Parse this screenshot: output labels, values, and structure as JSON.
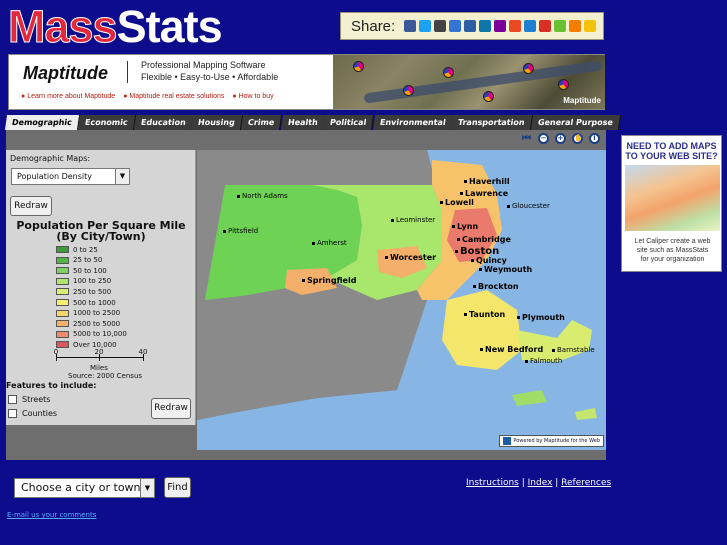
{
  "site": {
    "logo_mass": "Mass",
    "logo_stats": "Stats"
  },
  "share": {
    "label": "Share:",
    "icons": [
      "facebook-icon",
      "twitter-icon",
      "myspace-icon",
      "delicious-icon",
      "digg-icon",
      "linkedin-icon",
      "yahoo-icon",
      "stumbleupon-icon",
      "friendfeed-icon",
      "gmail-icon",
      "technorati-icon",
      "blogger-icon",
      "favorites-icon"
    ],
    "icon_colors": [
      "#3b5998",
      "#1da1f2",
      "#444444",
      "#3274d2",
      "#2d5ea3",
      "#0e76a8",
      "#7b0099",
      "#eb4924",
      "#1f7fd1",
      "#d93025",
      "#69c030",
      "#f57d00",
      "#f4c20d"
    ]
  },
  "banner": {
    "logo": "Maptitude",
    "tagline1": "Professional Mapping Software",
    "tagline2": "Flexible • Easy-to-Use • Affordable",
    "links": [
      "Learn more about Maptitude",
      "Maptitude real estate solutions",
      "How to buy"
    ],
    "map_badge": "Maptitude"
  },
  "tabs": [
    "Demographic",
    "Economic",
    "Education",
    "Housing",
    "Crime",
    "Health",
    "Political",
    "Environmental",
    "Transportation",
    "General Purpose"
  ],
  "active_tab": "Demographic",
  "toolbar": {
    "icons": [
      "first-page-icon",
      "zoom-out-icon",
      "zoom-in-icon",
      "pan-hand-icon",
      "info-icon"
    ],
    "glyphs": [
      "⏮",
      "−",
      "+",
      "✋",
      "i"
    ]
  },
  "sidebar": {
    "map_label": "Demographic Maps:",
    "map_select": "Population Density",
    "redraw_label": "Redraw",
    "legend_title": "Population Per Square Mile",
    "legend_subtitle": "(By City/Town)",
    "legend": [
      {
        "label": "0 to 25",
        "color": "#3f9b3a"
      },
      {
        "label": "25 to 50",
        "color": "#54b446"
      },
      {
        "label": "50 to 100",
        "color": "#7fd060"
      },
      {
        "label": "100 to 250",
        "color": "#aee66f"
      },
      {
        "label": "250 to 500",
        "color": "#d6ee72"
      },
      {
        "label": "500 to 1000",
        "color": "#f7ef6b"
      },
      {
        "label": "1000 to 2500",
        "color": "#f8d36a"
      },
      {
        "label": "2500 to 5000",
        "color": "#f5b06a"
      },
      {
        "label": "5000 to 10,000",
        "color": "#ee8a6f"
      },
      {
        "label": "Over 10,000",
        "color": "#d85a60"
      }
    ],
    "scale_ticks": [
      "0",
      "20",
      "40"
    ],
    "scale_unit": "Miles",
    "source": "Source: 2000 Census",
    "features_label": "Features to include:",
    "features": [
      {
        "label": "Streets",
        "checked": false
      },
      {
        "label": "Counties",
        "checked": false
      }
    ],
    "redraw2_label": "Redraw"
  },
  "map": {
    "cities": [
      {
        "name": "Haverhill",
        "cls": "b"
      },
      {
        "name": "Lawrence",
        "cls": "b"
      },
      {
        "name": "Lowell",
        "cls": "b"
      },
      {
        "name": "Gloucester",
        "cls": ""
      },
      {
        "name": "North Adams",
        "cls": ""
      },
      {
        "name": "Leominster",
        "cls": ""
      },
      {
        "name": "Lynn",
        "cls": "b"
      },
      {
        "name": "Cambridge",
        "cls": "b"
      },
      {
        "name": "Boston",
        "cls": "xl"
      },
      {
        "name": "Pittsfield",
        "cls": ""
      },
      {
        "name": "Amherst",
        "cls": ""
      },
      {
        "name": "Worcester",
        "cls": "b"
      },
      {
        "name": "Quincy",
        "cls": "b"
      },
      {
        "name": "Weymouth",
        "cls": "b"
      },
      {
        "name": "Springfield",
        "cls": "b"
      },
      {
        "name": "Brockton",
        "cls": "b"
      },
      {
        "name": "Taunton",
        "cls": "b"
      },
      {
        "name": "Plymouth",
        "cls": "b"
      },
      {
        "name": "New Bedford",
        "cls": "b"
      },
      {
        "name": "Barnstable",
        "cls": ""
      },
      {
        "name": "Falmouth",
        "cls": ""
      }
    ],
    "powered_by": "Powered by Maptitude for the Web"
  },
  "bottom": {
    "city_select": "Choose a city or town:",
    "find_label": "Find",
    "links": [
      "Instructions",
      "Index",
      "References"
    ],
    "email": "E-mail us your comments"
  },
  "ad": {
    "heading1": "NEED TO ADD MAPS",
    "heading2": "TO YOUR WEB SITE?",
    "text1": "Let Caliper create a web",
    "text2": "site such as MassStats",
    "text3": "for your organization"
  }
}
